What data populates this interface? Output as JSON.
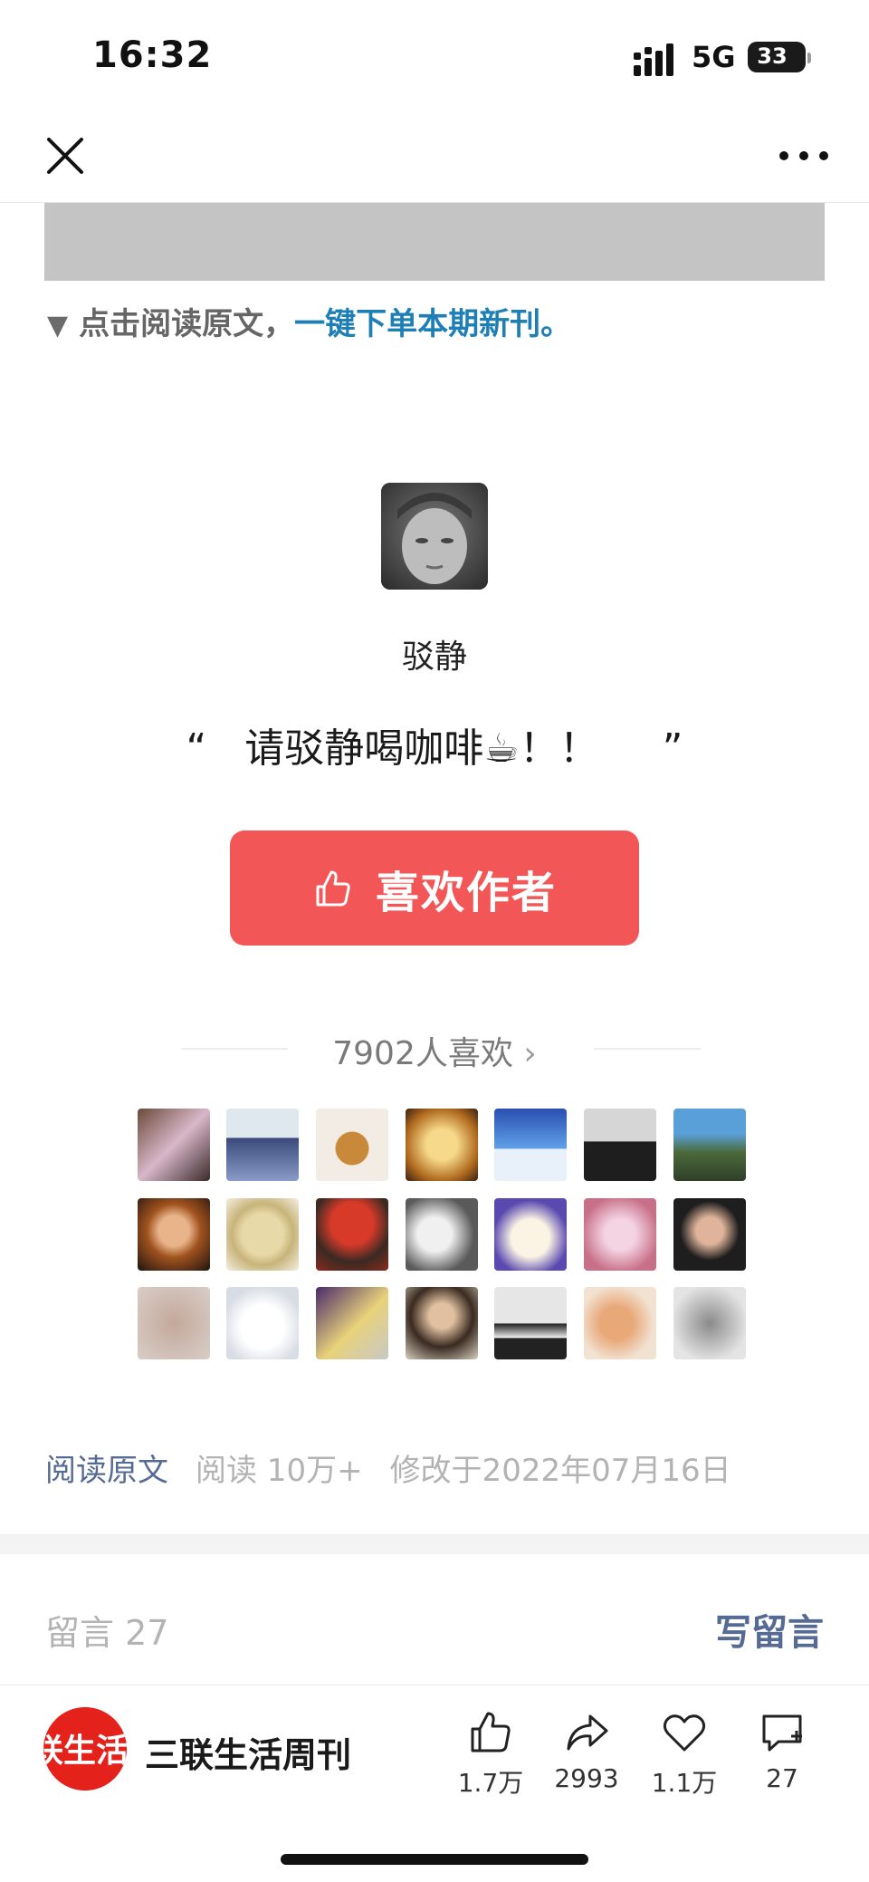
{
  "status": {
    "time": "16:32",
    "network": "5G",
    "battery": "33"
  },
  "nav": {
    "close_icon": "close-icon",
    "more_icon": "more-icon"
  },
  "promo": {
    "arrow": "▼",
    "prefix": "点击阅读原文，",
    "link": "一键下单本期新刊。",
    "link_color": "#1d7fb5"
  },
  "author": {
    "name": "驳静",
    "quote_open": "“",
    "quote_text": "请驳静喝咖啡☕！！",
    "quote_close": "”"
  },
  "like_button": {
    "label": "喜欢作者",
    "color": "#f35656"
  },
  "likers": {
    "count_text": "7902人喜欢",
    "chevron": "›"
  },
  "meta": {
    "read_original": "阅读原文",
    "reads": "阅读 10万+",
    "modified": "修改于2022年07月16日"
  },
  "comments": {
    "title": "留言 27",
    "write": "写留言"
  },
  "footer": {
    "account_name": "三联生活周刊",
    "logo_text": "联生活",
    "actions": [
      {
        "icon": "thumbs-up-icon",
        "count": "1.7万"
      },
      {
        "icon": "share-icon",
        "count": "2993"
      },
      {
        "icon": "heart-icon",
        "count": "1.1万"
      },
      {
        "icon": "comment-icon",
        "count": "27"
      }
    ]
  }
}
